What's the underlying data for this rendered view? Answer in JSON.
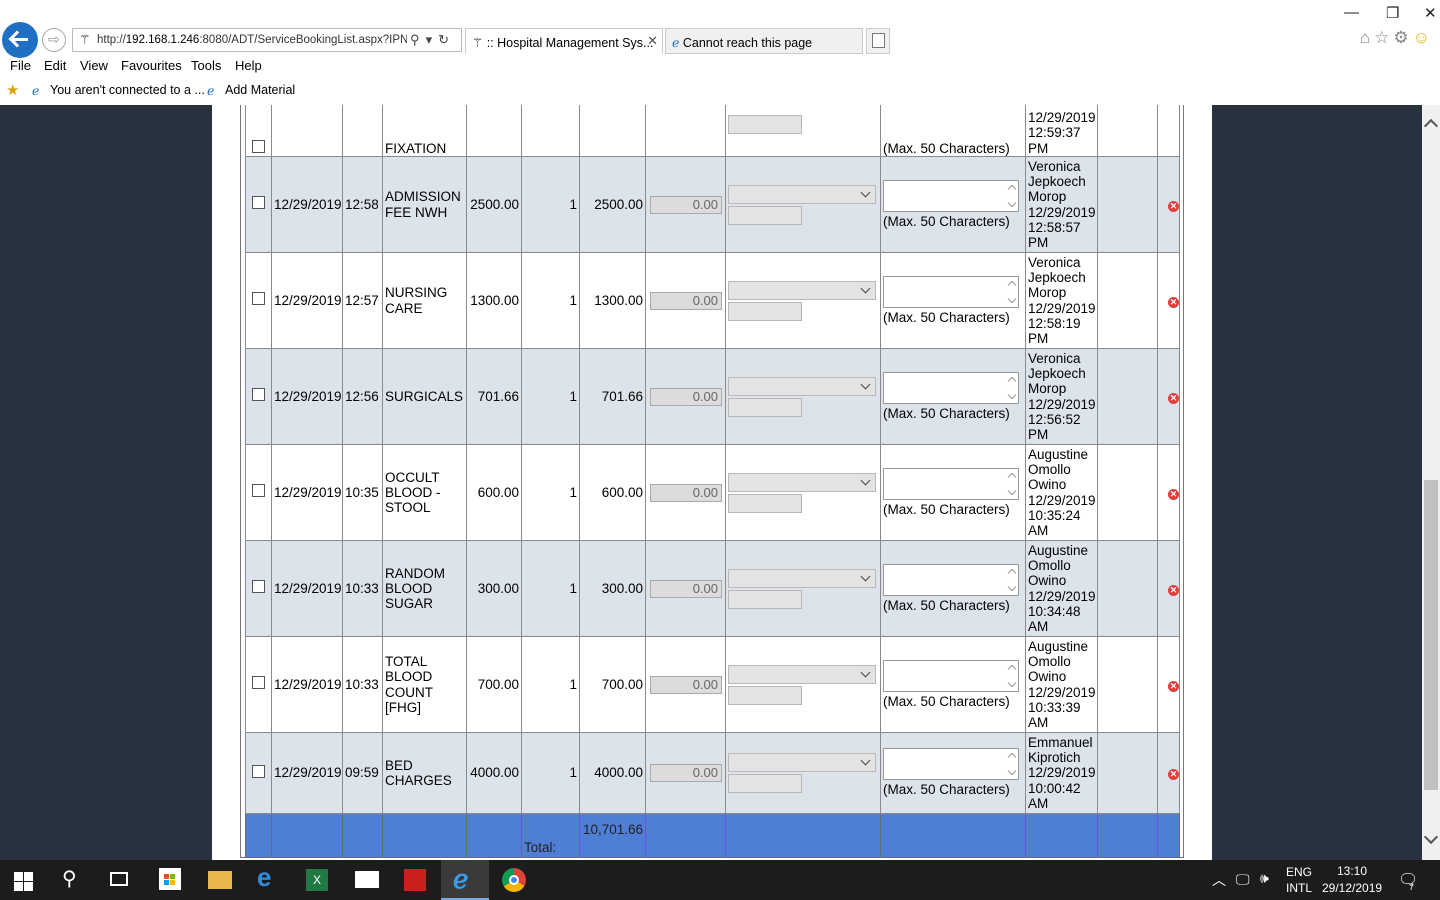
{
  "browser": {
    "url_prefix": "http://",
    "url_host": "192.168.1.246",
    "url_rest": ":8080/ADT/ServiceBookingList.aspx?IPN",
    "tabs": [
      {
        "label": ":: Hospital Management Sys..."
      },
      {
        "label": "Cannot reach this page"
      }
    ],
    "menu": [
      "File",
      "Edit",
      "View",
      "Favourites",
      "Tools",
      "Help"
    ],
    "favourites": [
      {
        "label": "You aren't connected to a ..."
      },
      {
        "label": "Add Material"
      }
    ]
  },
  "table": {
    "rows": [
      {
        "date": "",
        "time": "",
        "service": "FIXATION",
        "rate": "",
        "qty": "",
        "amount": "",
        "discount": "",
        "max_note": "(Max. 50 Characters)",
        "user": "12/29/2019 12:59:37 PM",
        "partial": true
      },
      {
        "date": "12/29/2019",
        "time": "12:58",
        "service": "ADMISSION FEE NWH",
        "rate": "2500.00",
        "qty": "1",
        "amount": "2500.00",
        "discount": "0.00",
        "max_note": "(Max. 50 Characters)",
        "user": "Veronica Jepkoech Morop 12/29/2019 12:58:57 PM"
      },
      {
        "date": "12/29/2019",
        "time": "12:57",
        "service": "NURSING CARE",
        "rate": "1300.00",
        "qty": "1",
        "amount": "1300.00",
        "discount": "0.00",
        "max_note": "(Max. 50 Characters)",
        "user": "Veronica Jepkoech Morop 12/29/2019 12:58:19 PM"
      },
      {
        "date": "12/29/2019",
        "time": "12:56",
        "service": "SURGICALS",
        "rate": "701.66",
        "qty": "1",
        "amount": "701.66",
        "discount": "0.00",
        "max_note": "(Max. 50 Characters)",
        "user": "Veronica Jepkoech Morop 12/29/2019 12:56:52 PM"
      },
      {
        "date": "12/29/2019",
        "time": "10:35",
        "service": "OCCULT BLOOD - STOOL",
        "rate": "600.00",
        "qty": "1",
        "amount": "600.00",
        "discount": "0.00",
        "max_note": "(Max. 50 Characters)",
        "user": "Augustine Omollo Owino 12/29/2019 10:35:24 AM"
      },
      {
        "date": "12/29/2019",
        "time": "10:33",
        "service": "RANDOM BLOOD SUGAR",
        "rate": "300.00",
        "qty": "1",
        "amount": "300.00",
        "discount": "0.00",
        "max_note": "(Max. 50 Characters)",
        "user": "Augustine Omollo Owino 12/29/2019 10:34:48 AM"
      },
      {
        "date": "12/29/2019",
        "time": "10:33",
        "service": "TOTAL BLOOD COUNT [FHG]",
        "rate": "700.00",
        "qty": "1",
        "amount": "700.00",
        "discount": "0.00",
        "max_note": "(Max. 50 Characters)",
        "user": "Augustine Omollo Owino 12/29/2019 10:33:39 AM"
      },
      {
        "date": "12/29/2019",
        "time": "09:59",
        "service": "BED CHARGES",
        "rate": "4000.00",
        "qty": "1",
        "amount": "4000.00",
        "discount": "0.00",
        "max_note": "(Max. 50 Characters)",
        "user": "Emmanuel Kiprotich 12/29/2019 10:00:42 AM"
      }
    ],
    "total_label": "Total:",
    "total_value": "10,701.66"
  },
  "taskbar": {
    "language": "ENG",
    "layout": "INTL",
    "time": "13:10",
    "date": "29/12/2019",
    "notifications": "7"
  },
  "colors": {
    "page_bg": "#28323f",
    "row_alt": "#dde3ea",
    "total_row": "#4f7fd4",
    "delete_icon": "#e23c3c"
  }
}
